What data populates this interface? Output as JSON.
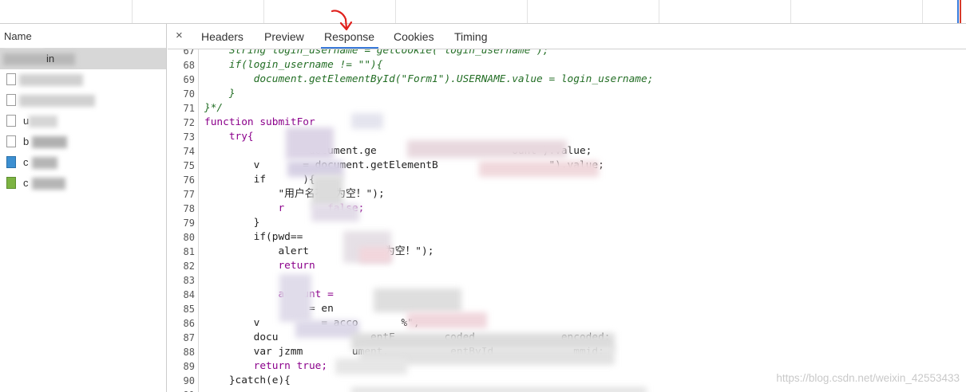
{
  "left_panel": {
    "header": "Name",
    "rows": [
      {
        "label": "in",
        "type": "doc",
        "selected": true
      },
      {
        "label": "",
        "type": "doc",
        "selected": false
      },
      {
        "label": "",
        "type": "doc",
        "selected": false
      },
      {
        "label": "u",
        "type": "doc",
        "selected": false
      },
      {
        "label": "b",
        "type": "doc",
        "selected": false
      },
      {
        "label": "c",
        "type": "image",
        "selected": false
      },
      {
        "label": "c",
        "type": "script",
        "selected": false
      }
    ]
  },
  "tabs": {
    "close": "×",
    "headers": "Headers",
    "preview": "Preview",
    "response": "Response",
    "cookies": "Cookies",
    "timing": "Timing",
    "active": "Response"
  },
  "code": {
    "lines": [
      {
        "n": "67",
        "t": "    String login_username = getCookie(\"login_username\");",
        "k": "cmt"
      },
      {
        "n": "68",
        "t": "    if(login_username != \"\"){",
        "k": "cmt"
      },
      {
        "n": "69",
        "t": "        document.getElementById(\"Form1\").USERNAME.value = login_username;",
        "k": "cmt"
      },
      {
        "n": "70",
        "t": "    }",
        "k": "cmt"
      },
      {
        "n": "71",
        "t": "}*/",
        "k": "cmt"
      },
      {
        "n": "72",
        "t": "function submitFor",
        "k": "kw"
      },
      {
        "n": "73",
        "t": "    try{",
        "k": "kw"
      },
      {
        "n": "74",
        "t": "               = document.ge                      ount\").value;",
        "k": "tx"
      },
      {
        "n": "75",
        "t": "        v       = document.getElementB                  \").value;",
        "k": "tx"
      },
      {
        "n": "76",
        "t": "        if      ){",
        "k": "tx"
      },
      {
        "n": "77",
        "t": "            \"用户名不能为空！\");",
        "k": "tx"
      },
      {
        "n": "78",
        "t": "            r       false;",
        "k": "kw"
      },
      {
        "n": "79",
        "t": "        }",
        "k": "tx"
      },
      {
        "n": "80",
        "t": "        if(pwd==",
        "k": "tx"
      },
      {
        "n": "81",
        "t": "            alert         不能为空！\");",
        "k": "tx"
      },
      {
        "n": "82",
        "t": "            return",
        "k": "kw"
      },
      {
        "n": "83",
        "t": "",
        "k": "tx"
      },
      {
        "n": "84",
        "t": "            account =",
        "k": "kw"
      },
      {
        "n": "85",
        "t": "              wd = en",
        "k": "tx"
      },
      {
        "n": "86",
        "t": "        v          = acco       %\";",
        "k": "tx"
      },
      {
        "n": "87",
        "t": "        docu               entE        coded              encoded;",
        "k": "tx"
      },
      {
        "n": "88",
        "t": "        var jzmm        ument.          entById             mmid;",
        "k": "tx"
      },
      {
        "n": "89",
        "t": "        return true;",
        "k": "kw"
      },
      {
        "n": "90",
        "t": "    }catch(e){",
        "k": "tx"
      },
      {
        "n": "91",
        "t": "",
        "k": "tx"
      }
    ]
  },
  "watermark": "https://blog.csdn.net/weixin_42553433",
  "colors": {
    "comment": "#236e25",
    "keyword": "#8b008b",
    "tab_underline": "#3879d9",
    "arrow": "#e0201c"
  }
}
